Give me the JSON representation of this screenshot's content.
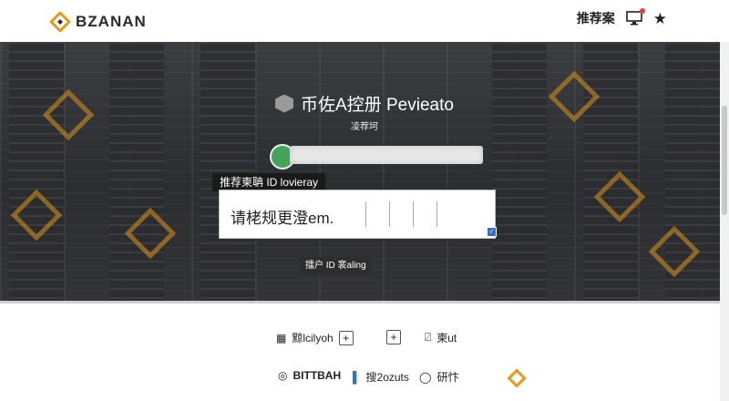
{
  "header": {
    "brand": "BZANAN",
    "referral_label": "推荐案"
  },
  "hero": {
    "title": "币佐A控册 Pevieato",
    "subtitle": "凌荐坷"
  },
  "form": {
    "tooltip": "推荐柬聃 ID lovieray",
    "code_text": "请栳规更澄em.",
    "submit_label": "擂户 ID 裵aling"
  },
  "links": {
    "item1": "黥lcilyoh",
    "item2": "",
    "item3": "柬ut"
  },
  "footer": {
    "brand": "BITTBAH",
    "item2": "搜2ozuts",
    "item3": "研忭"
  },
  "colors": {
    "accent": "#e69a1a",
    "hero_dark": "#333437",
    "checkbox_blue": "#2f6fd0"
  }
}
